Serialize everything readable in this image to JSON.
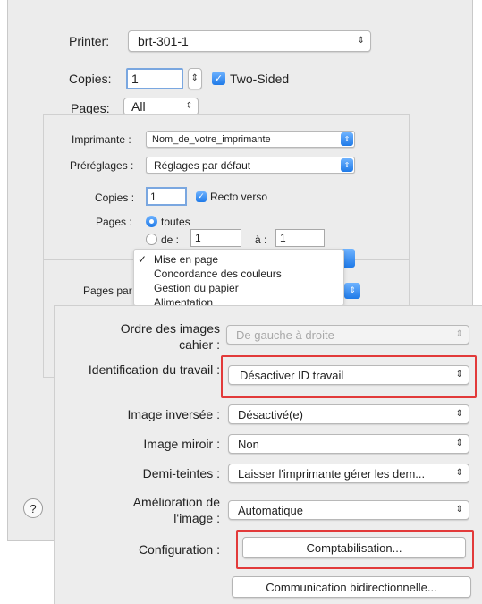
{
  "back_dialog": {
    "printer_label": "Printer:",
    "printer_value": "brt-301-1",
    "copies_label": "Copies:",
    "copies_value": "1",
    "two_sided_label": "Two-Sided",
    "pages_label": "Pages:",
    "pages_value": "All",
    "help_glyph": "?"
  },
  "fr_dialog": {
    "printer_label": "Imprimante :",
    "printer_value": "Nom_de_votre_imprimante",
    "presets_label": "Préréglages :",
    "presets_value": "Réglages par défaut",
    "copies_label": "Copies :",
    "copies_value": "1",
    "two_sided_label": "Recto verso",
    "pages_label": "Pages :",
    "pages_all_label": "toutes",
    "pages_from_label": "de :",
    "pages_from_value": "1",
    "pages_to_label": "à :",
    "pages_to_value": "1",
    "pages_per_label": "Pages par",
    "menu_items": [
      {
        "label": "Mise en page",
        "checked": true
      },
      {
        "label": "Concordance des couleurs",
        "checked": false
      },
      {
        "label": "Gestion du papier",
        "checked": false
      },
      {
        "label": "Alimentation",
        "checked": false
      }
    ],
    "check_mark": "✓"
  },
  "options_panel": {
    "page_order_label_1": "Ordre des images",
    "page_order_label_2": "cahier :",
    "page_order_value": "De gauche à droite",
    "job_id_label": "Identification du travail :",
    "job_id_value": "Désactiver ID travail",
    "inverted_label": "Image inversée :",
    "inverted_value": "Désactivé(e)",
    "mirror_label": "Image miroir :",
    "mirror_value": "Non",
    "halftone_label": "Demi-teintes :",
    "halftone_value": "Laisser l'imprimante gérer les dem...",
    "enhance_label_1": "Amélioration de",
    "enhance_label_2": "l'image :",
    "enhance_value": "Automatique",
    "config_label": "Configuration :",
    "accounting_button": "Comptabilisation...",
    "bidirectional_button": "Communication bidirectionnelle..."
  },
  "icons": {
    "updown": "⌃⌄",
    "updown_arrows": "⇕"
  },
  "colors": {
    "accent_blue": "#1f7ae8",
    "highlight_red": "#e23a3a",
    "panel_bg": "#ececec"
  }
}
